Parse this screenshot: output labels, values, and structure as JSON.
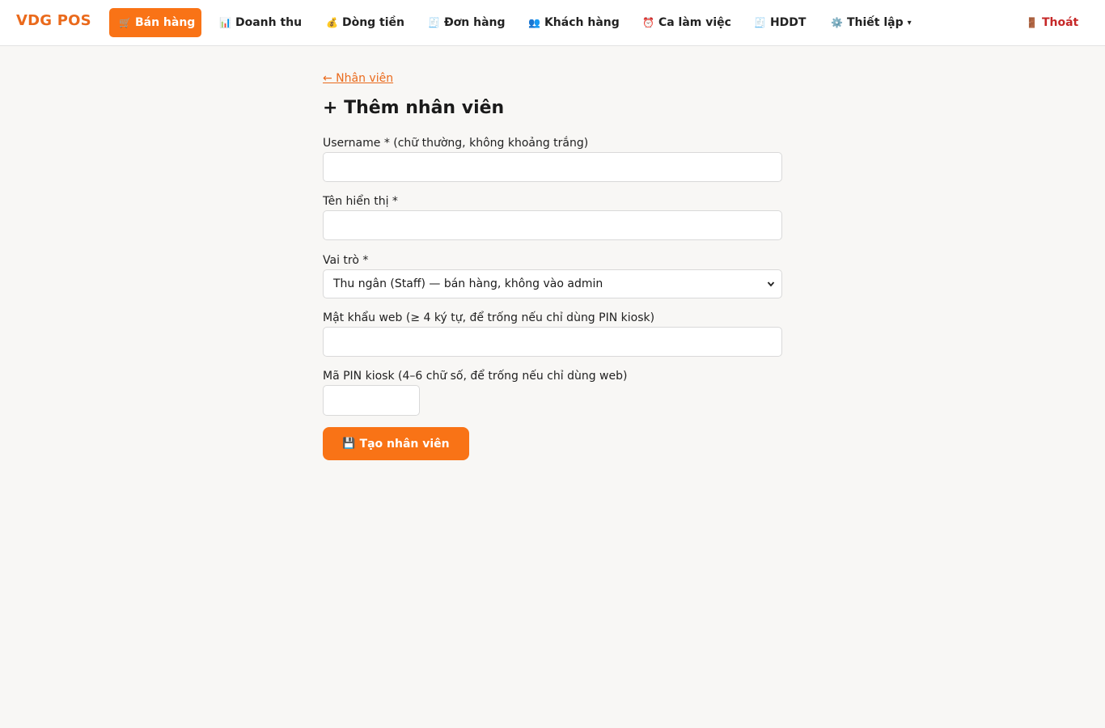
{
  "app": {
    "brand": "VDG POS"
  },
  "nav": {
    "items": [
      {
        "icon": "🛒",
        "label": "Bán hàng",
        "active": true
      },
      {
        "icon": "📊",
        "label": "Doanh thu"
      },
      {
        "icon": "💰",
        "label": "Dòng tiền"
      },
      {
        "icon": "🧾",
        "label": "Đơn hàng"
      },
      {
        "icon": "👥",
        "label": "Khách hàng"
      },
      {
        "icon": "⏰",
        "label": "Ca làm việc"
      },
      {
        "icon": "🧾",
        "label": "HDDT"
      },
      {
        "icon": "⚙️",
        "label": "Thiết lập",
        "caret": "▾"
      }
    ],
    "logout": {
      "icon": "🚪",
      "label": "Thoát"
    }
  },
  "page": {
    "back_link": "← Nhân viên",
    "title": "+ Thêm nhân viên"
  },
  "form": {
    "username": {
      "label": "Username * (chữ thường, không khoảng trắng)",
      "value": ""
    },
    "display_name": {
      "label": "Tên hiển thị *",
      "value": ""
    },
    "role": {
      "label": "Vai trò *",
      "selected": "Thu ngân (Staff) — bán hàng, không vào admin"
    },
    "web_password": {
      "label": "Mật khẩu web (≥ 4 ký tự, để trống nếu chỉ dùng PIN kiosk)",
      "value": ""
    },
    "kiosk_pin": {
      "label": "Mã PIN kiosk (4–6 chữ số, để trống nếu chỉ dùng web)",
      "value": ""
    },
    "submit": {
      "icon": "💾",
      "label": "Tạo nhân viên"
    }
  },
  "colors": {
    "accent": "#f97316",
    "brand": "#ea6a1c",
    "logout": "#c62828",
    "background": "#f8f7f5"
  }
}
